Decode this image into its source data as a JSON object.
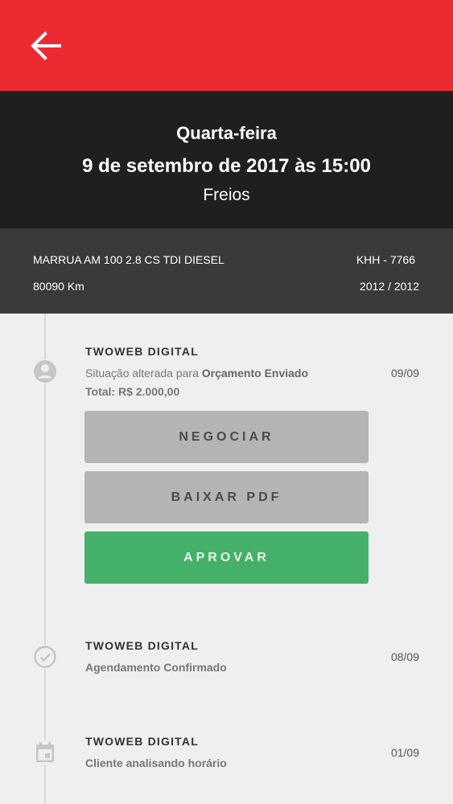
{
  "header": {
    "weekday": "Quarta-feira",
    "datetime": "9 de setembro de 2017 às 15:00",
    "service": "Freios"
  },
  "vehicle": {
    "model": "MARRUA AM 100 2.8 CS TDI DIESEL",
    "plate": "KHH - 7766",
    "km": "80090 Km",
    "year": "2012 / 2012"
  },
  "timeline": [
    {
      "icon": "user-icon",
      "company": "TWOWEB DIGITAL",
      "status_prefix": "Situação alterada para ",
      "status_bold": "Orçamento Enviado",
      "total": "Total: R$ 2.000,00",
      "date": "09/09",
      "buttons": {
        "negotiate": "NEGOCIAR",
        "download": "BAIXAR PDF",
        "approve": "APROVAR"
      }
    },
    {
      "icon": "check-circle-icon",
      "company": "TWOWEB DIGITAL",
      "status": "Agendamento Confirmado",
      "date": "08/09"
    },
    {
      "icon": "calendar-icon",
      "company": "TWOWEB DIGITAL",
      "status": "Cliente analisando horário",
      "date": "01/09"
    }
  ],
  "colors": {
    "topbar": "#ec2a32",
    "header": "#211f1e",
    "vehicle_bar": "#3a3a3b",
    "approve": "#44b06a",
    "secondary_button": "#b4b4b6"
  }
}
